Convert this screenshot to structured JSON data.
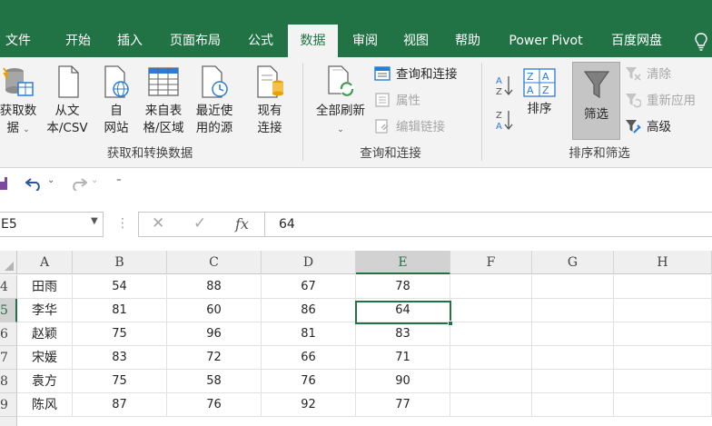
{
  "tabs": [
    {
      "label": "文件",
      "active": false
    },
    {
      "label": "开始",
      "active": false
    },
    {
      "label": "插入",
      "active": false
    },
    {
      "label": "页面布局",
      "active": false
    },
    {
      "label": "公式",
      "active": false
    },
    {
      "label": "数据",
      "active": true
    },
    {
      "label": "审阅",
      "active": false
    },
    {
      "label": "视图",
      "active": false
    },
    {
      "label": "帮助",
      "active": false
    },
    {
      "label": "Power Pivot",
      "active": false
    },
    {
      "label": "百度网盘",
      "active": false
    }
  ],
  "ribbon": {
    "get_data": {
      "line1": "获取数",
      "line2": "据"
    },
    "from_text": {
      "line1": "从文",
      "line2": "本/CSV"
    },
    "from_web": {
      "line1": "自",
      "line2": "网站"
    },
    "from_table": {
      "line1": "来自表",
      "line2": "格/区域"
    },
    "recent_sources": {
      "line1": "最近使",
      "line2": "用的源"
    },
    "existing_conn": {
      "line1": "现有",
      "line2": "连接"
    },
    "group1_label": "获取和转换数据",
    "refresh_all": "全部刷新",
    "queries_conn": "查询和连接",
    "properties": "属性",
    "edit_links": "编辑链接",
    "group2_label": "查询和连接",
    "sort": "排序",
    "filter": "筛选",
    "clear": "清除",
    "reapply": "重新应用",
    "advanced": "高级",
    "group3_label": "排序和筛选"
  },
  "formula_bar": {
    "name_box": "E5",
    "formula": "64"
  },
  "grid": {
    "columns": [
      "A",
      "B",
      "C",
      "D",
      "E",
      "F",
      "G",
      "H"
    ],
    "selected_column": "E",
    "rows": [
      {
        "num": "4",
        "a": "田雨",
        "b": "54",
        "c": "88",
        "d": "67",
        "e": "78"
      },
      {
        "num": "5",
        "a": "李华",
        "b": "81",
        "c": "60",
        "d": "86",
        "e": "64"
      },
      {
        "num": "6",
        "a": "赵颖",
        "b": "75",
        "c": "96",
        "d": "81",
        "e": "83"
      },
      {
        "num": "7",
        "a": "宋媛",
        "b": "83",
        "c": "72",
        "d": "66",
        "e": "71"
      },
      {
        "num": "8",
        "a": "袁方",
        "b": "75",
        "c": "58",
        "d": "76",
        "e": "90"
      },
      {
        "num": "9",
        "a": "陈风",
        "b": "87",
        "c": "76",
        "d": "92",
        "e": "77"
      }
    ],
    "selected_row": "5"
  },
  "colors": {
    "brand": "#217346",
    "ribbon_bg": "#f3f3f3"
  }
}
